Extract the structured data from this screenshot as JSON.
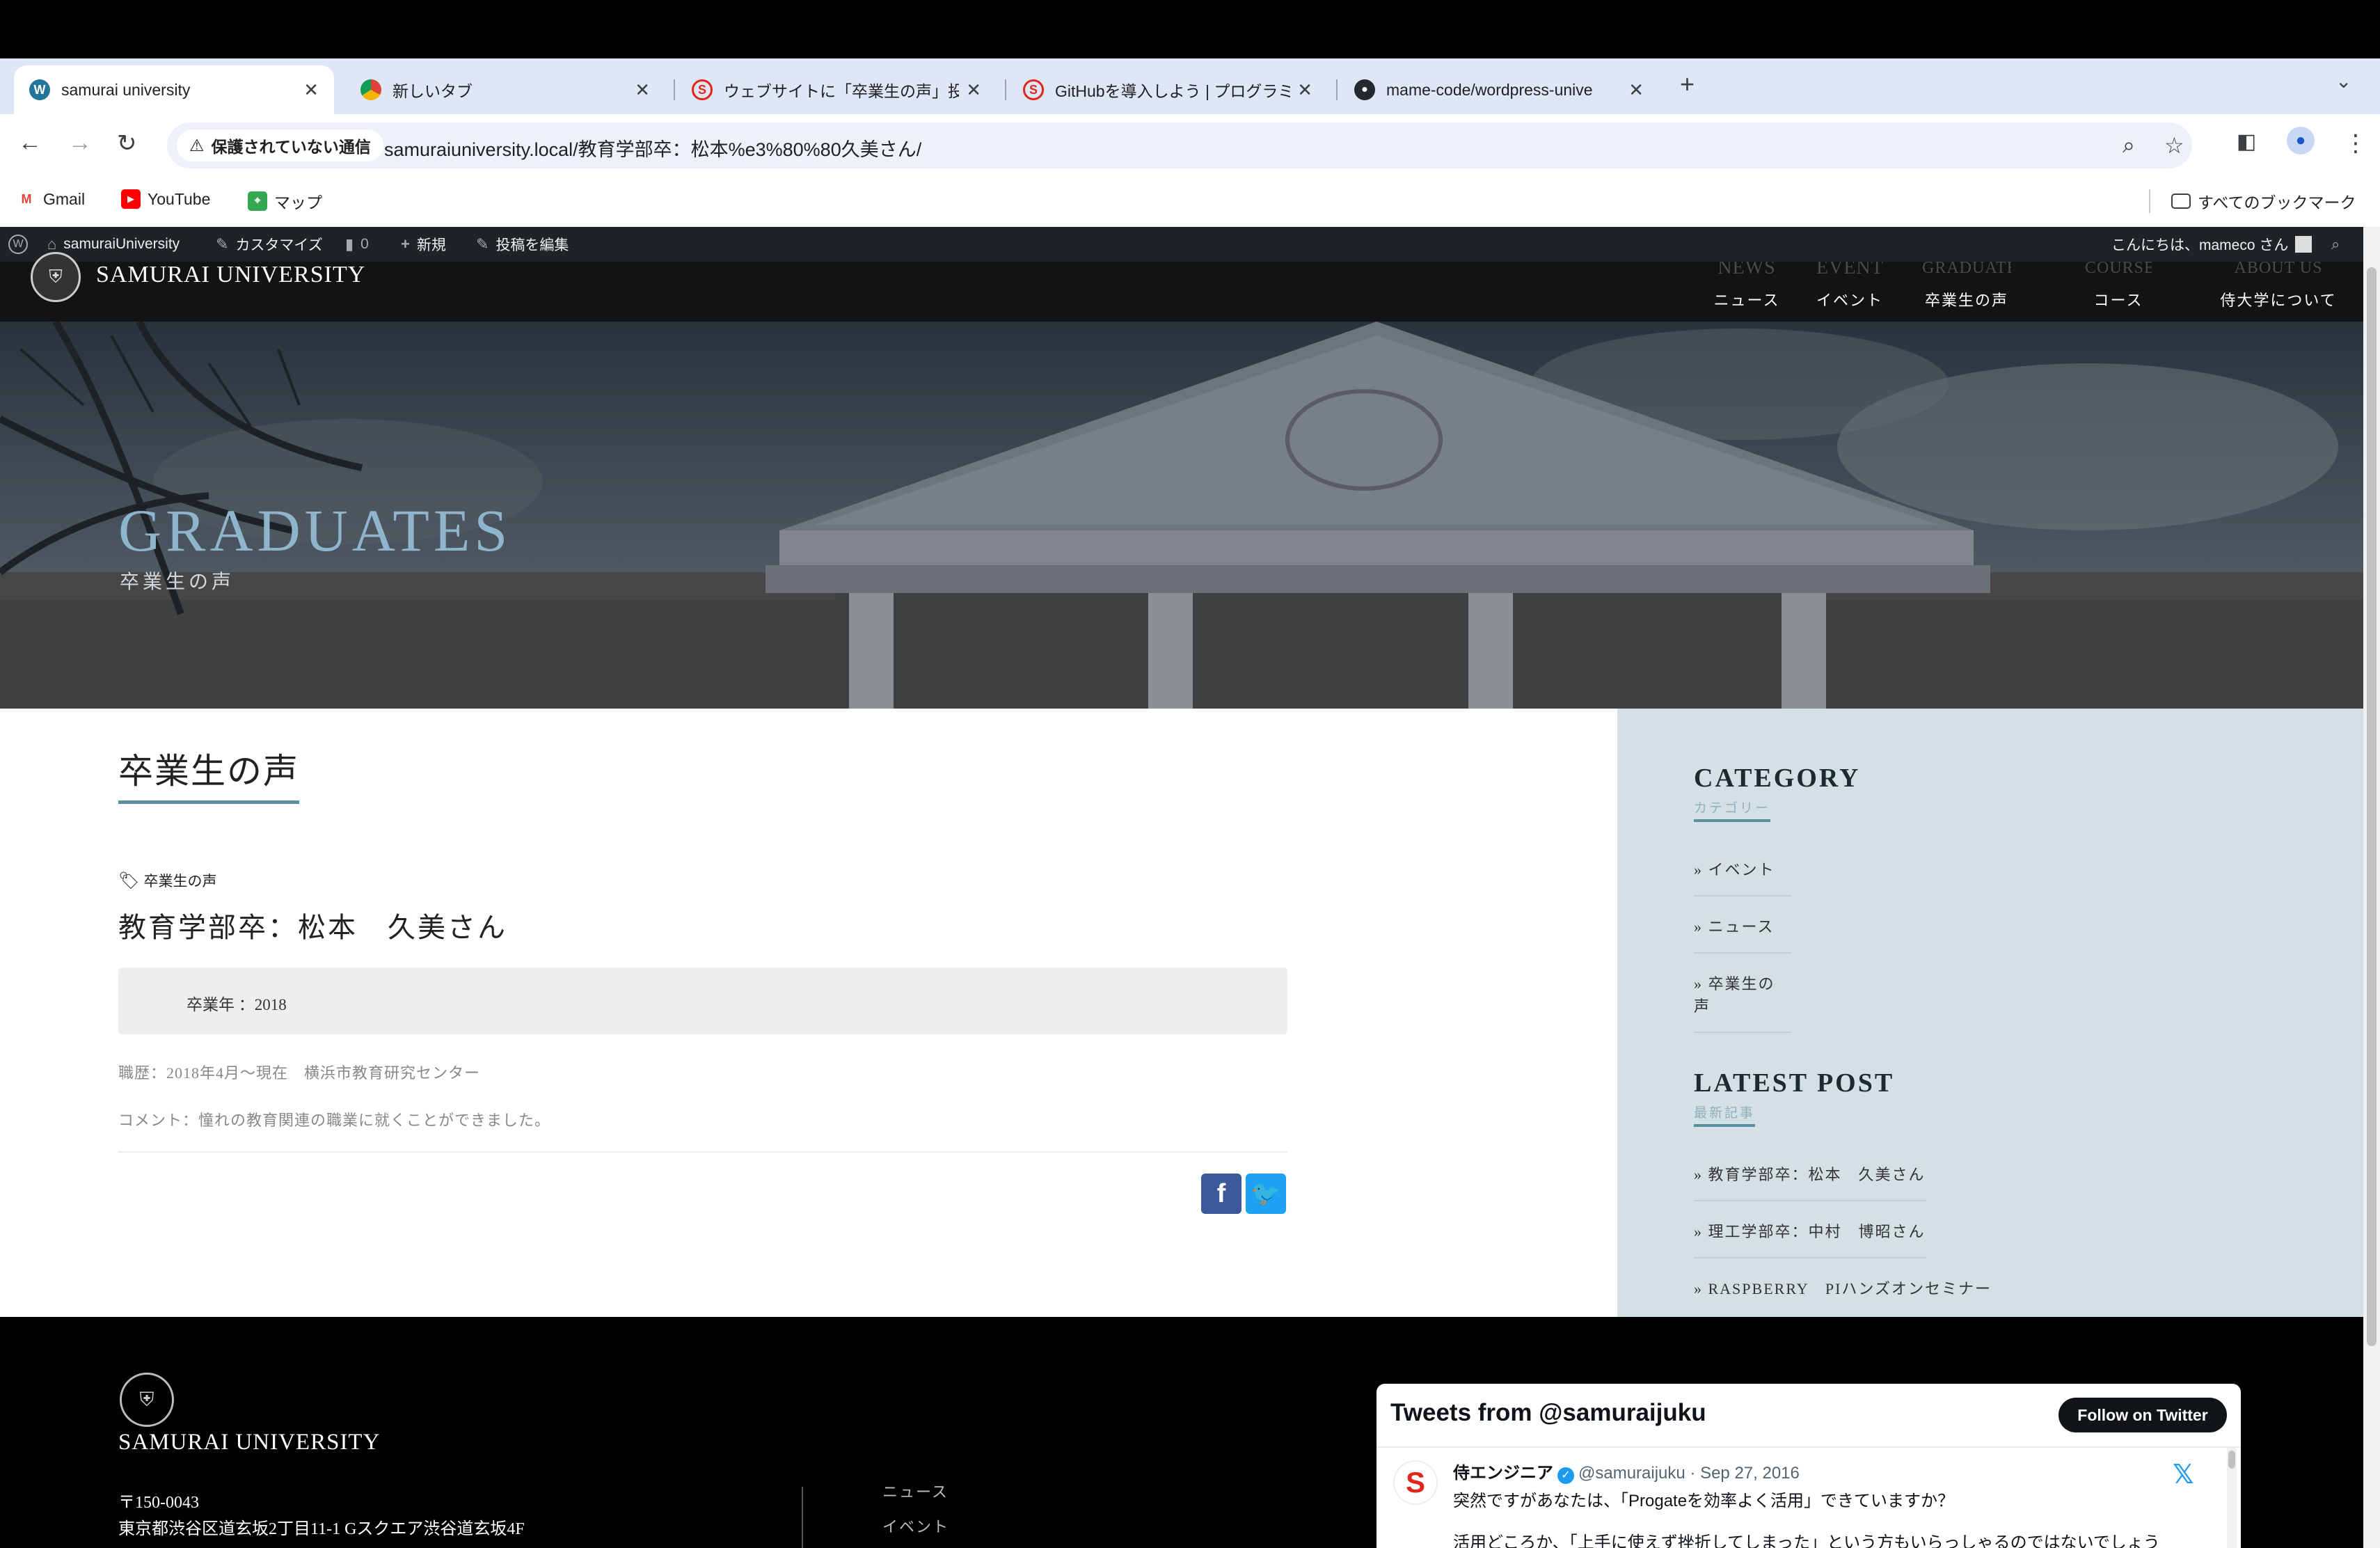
{
  "browser": {
    "tabs": [
      {
        "title": "samurai university",
        "icon": "wordpress-icon",
        "active": true
      },
      {
        "title": "新しいタブ",
        "icon": "chrome-icon",
        "active": false
      },
      {
        "title": "ウェブサイトに「卒業生の声」投",
        "icon": "samurai-icon",
        "active": false
      },
      {
        "title": "GitHubを導入しよう | プログラミ",
        "icon": "samurai-icon",
        "active": false
      },
      {
        "title": "mame-code/wordpress-unive",
        "icon": "github-icon",
        "active": false
      }
    ],
    "security_label": "保護されていない通信",
    "url": "samuraiuniversity.local/教育学部卒：松本%e3%80%80久美さん/",
    "bookmarks": [
      {
        "label": "Gmail",
        "icon": "gmail-icon"
      },
      {
        "label": "YouTube",
        "icon": "youtube-icon"
      },
      {
        "label": "マップ",
        "icon": "maps-icon"
      }
    ],
    "all_bookmarks_label": "すべてのブックマーク"
  },
  "admin_bar": {
    "site": "samuraiUniversity",
    "customize": "カスタマイズ",
    "comments": "0",
    "new": "新規",
    "edit": "投稿を編集",
    "greeting": "こんにちは、mameco さん"
  },
  "header": {
    "site_name": "SAMURAI UNIVERSITY",
    "nav": [
      {
        "en": "NEWS",
        "jp": "ニュース"
      },
      {
        "en": "EVENT",
        "jp": "イベント"
      },
      {
        "en": "GRADUATES",
        "jp": "卒業生の声"
      },
      {
        "en": "COURSES",
        "jp": "コース"
      },
      {
        "en": "ABOUT US",
        "jp": "侍大学について"
      }
    ]
  },
  "hero": {
    "title": "GRADUATES",
    "subtitle": "卒業生の声"
  },
  "post": {
    "heading": "卒業生の声",
    "category": "卒業生の声",
    "title": "教育学部卒：松本　久美さん",
    "graduation_year": "卒業年 ：2018",
    "career": "職歴：2018年4月～現在　横浜市教育研究センター",
    "comment": "コメント：憧れの教育関連の職業に就くことができました。"
  },
  "sidebar": {
    "category_title": "CATEGORY",
    "category_sub": "カテゴリー",
    "categories": [
      "イベント",
      "ニュース",
      "卒業生の声"
    ],
    "latest_title": "LATEST POST",
    "latest_sub": "最新記事",
    "latest_posts": [
      "教育学部卒：松本　久美さん",
      "理工学部卒：中村　博昭さん",
      "RASPBERRY　PIハンズオンセミナー"
    ]
  },
  "footer": {
    "name": "SAMURAI UNIVERSITY",
    "postal": "〒150-0043",
    "address": "東京都渋谷区道玄坂2丁目11-1 Gスクエア渋谷道玄坂4F",
    "links": [
      "ニュース",
      "イベント"
    ]
  },
  "twitter": {
    "header": "Tweets from @samuraijuku",
    "follow": "Follow on Twitter",
    "author": "侍エンジニア",
    "handle": "@samuraijuku · Sep 27, 2016",
    "text1": "突然ですがあなたは、「Progateを効率よく活用」できていますか？",
    "text2": "活用どころか、「上手に使えず挫折してしまった」という方もいらっしゃるのではないでしょう"
  },
  "colors": {
    "accent": "#5a8fa0",
    "hero_title": "#8fb5cc",
    "sidebar_bg": "#d5e0e4",
    "facebook": "#3b5998",
    "twitter": "#1da1f2"
  }
}
